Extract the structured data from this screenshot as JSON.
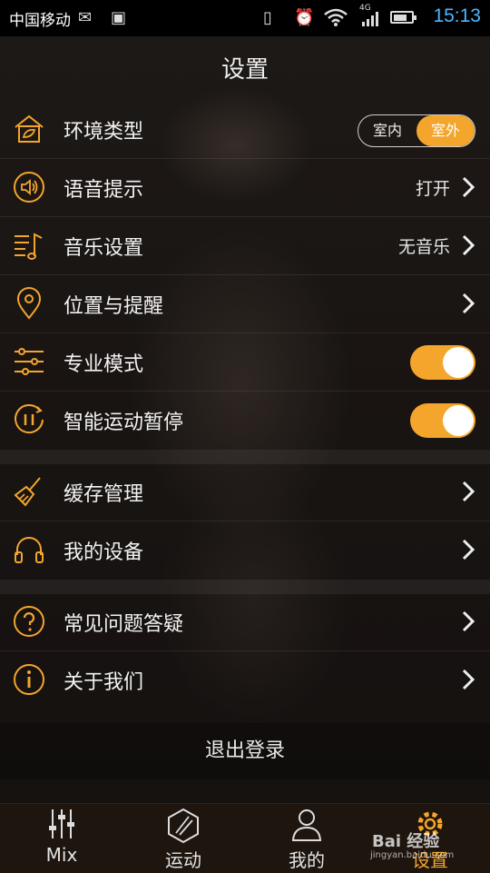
{
  "status_bar": {
    "carrier": "中国移动",
    "network": "4G",
    "time": "15:13"
  },
  "page": {
    "title": "设置"
  },
  "settings": {
    "environment": {
      "label": "环境类型",
      "options": [
        "室内",
        "室外"
      ],
      "selected": "室外"
    },
    "voice": {
      "label": "语音提示",
      "value": "打开"
    },
    "music": {
      "label": "音乐设置",
      "value": "无音乐"
    },
    "location": {
      "label": "位置与提醒"
    },
    "pro_mode": {
      "label": "专业模式",
      "enabled": true
    },
    "auto_pause": {
      "label": "智能运动暂停",
      "enabled": true
    },
    "cache": {
      "label": "缓存管理"
    },
    "devices": {
      "label": "我的设备"
    },
    "faq": {
      "label": "常见问题答疑"
    },
    "about": {
      "label": "关于我们"
    }
  },
  "logout_label": "退出登录",
  "tabs": [
    {
      "label": "Mix",
      "icon": "mixer-icon"
    },
    {
      "label": "运动",
      "icon": "hexagon-icon"
    },
    {
      "label": "我的",
      "icon": "person-icon"
    },
    {
      "label": "设置",
      "icon": "gear-icon",
      "active": true
    }
  ],
  "watermark": {
    "brand": "Bai 经验",
    "url": "jingyan.baidu.com"
  },
  "colors": {
    "accent": "#f4a52b",
    "time": "#4fb6ff"
  }
}
